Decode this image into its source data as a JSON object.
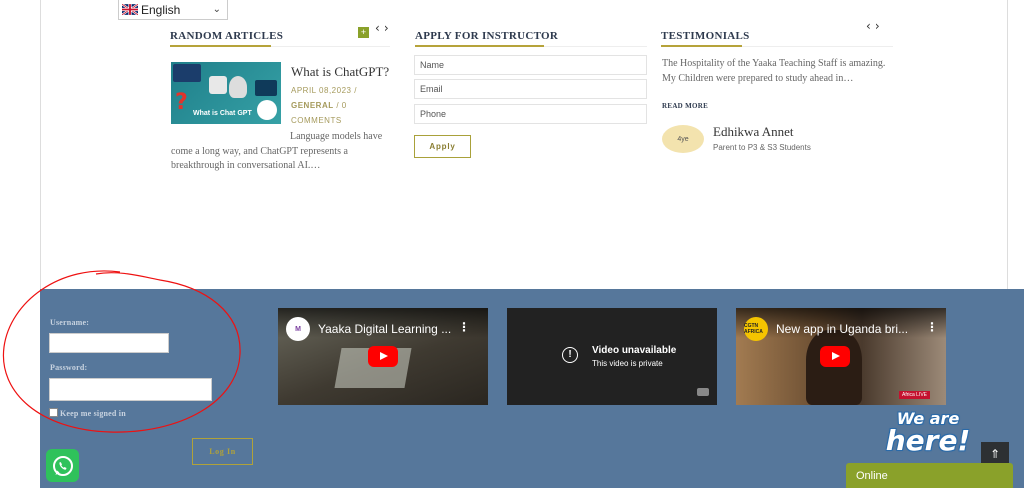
{
  "language_selector": {
    "value": "English",
    "flag_icon": "uk-flag-icon"
  },
  "random_articles": {
    "heading": "RANDOM ARTICLES",
    "article": {
      "thumbnail_caption": "What is Chat GPT",
      "title": "What is ChatGPT?",
      "date": "APRIL 08,2023",
      "category": "GENERAL",
      "comments": "0 COMMENTS",
      "excerpt": "Language models have come a long way, and ChatGPT represents a breakthrough in conversational AI.…"
    }
  },
  "apply_instructor": {
    "heading": "APPLY FOR INSTRUCTOR",
    "fields": {
      "name_placeholder": "Name",
      "email_placeholder": "Email",
      "phone_placeholder": "Phone"
    },
    "submit_label": "Apply"
  },
  "testimonials": {
    "heading": "TESTIMONIALS",
    "quote": "The Hospitality of the Yaaka Teaching Staff is amazing. My Children were prepared to study ahead in…",
    "read_more": "READ MORE",
    "avatar_alt": "4ye",
    "person_name": "Edhikwa Annet",
    "person_role": "Parent to P3 & S3 Students"
  },
  "login": {
    "username_label": "Username:",
    "password_label": "Password:",
    "remember_label": "Keep me signed in",
    "submit_label": "Log In"
  },
  "videos": [
    {
      "title": "Yaaka Digital Learning ...",
      "channel": "M",
      "status": "playable"
    },
    {
      "title": "Video unavailable",
      "subtitle": "This video is private",
      "status": "private"
    },
    {
      "title": "New app in Uganda bri...",
      "channel": "CGTN AFRICA",
      "status": "playable",
      "badge": "Africa LIVE"
    }
  ],
  "chat_widget": {
    "tagline_1": "We are",
    "tagline_2": "here!",
    "status": "Online"
  },
  "colors": {
    "accent": "#b6a33a",
    "footer_bg": "#56779b",
    "online_green": "#8aa12a"
  }
}
